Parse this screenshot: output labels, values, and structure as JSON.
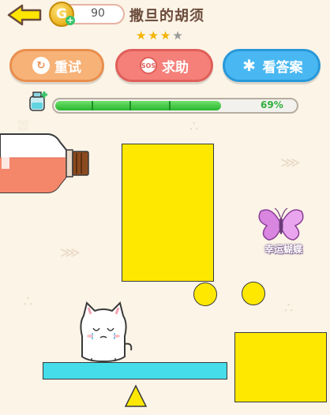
{
  "header": {
    "coins": "90",
    "coin_symbol": "G",
    "level_title": "撒旦的胡须",
    "stars": [
      true,
      true,
      true,
      false
    ]
  },
  "buttons": {
    "retry": "重试",
    "help": "求助",
    "help_icon_text": "SOS",
    "answer": "看答案"
  },
  "progress": {
    "percent_label": "69%",
    "value": 0.69
  },
  "scene": {
    "lucky_butterfly_label": "幸运蝴蝶"
  },
  "colors": {
    "accent_yellow": "#ffe800",
    "platform_cyan": "#45dde9",
    "progress_green": "#28b52f"
  }
}
